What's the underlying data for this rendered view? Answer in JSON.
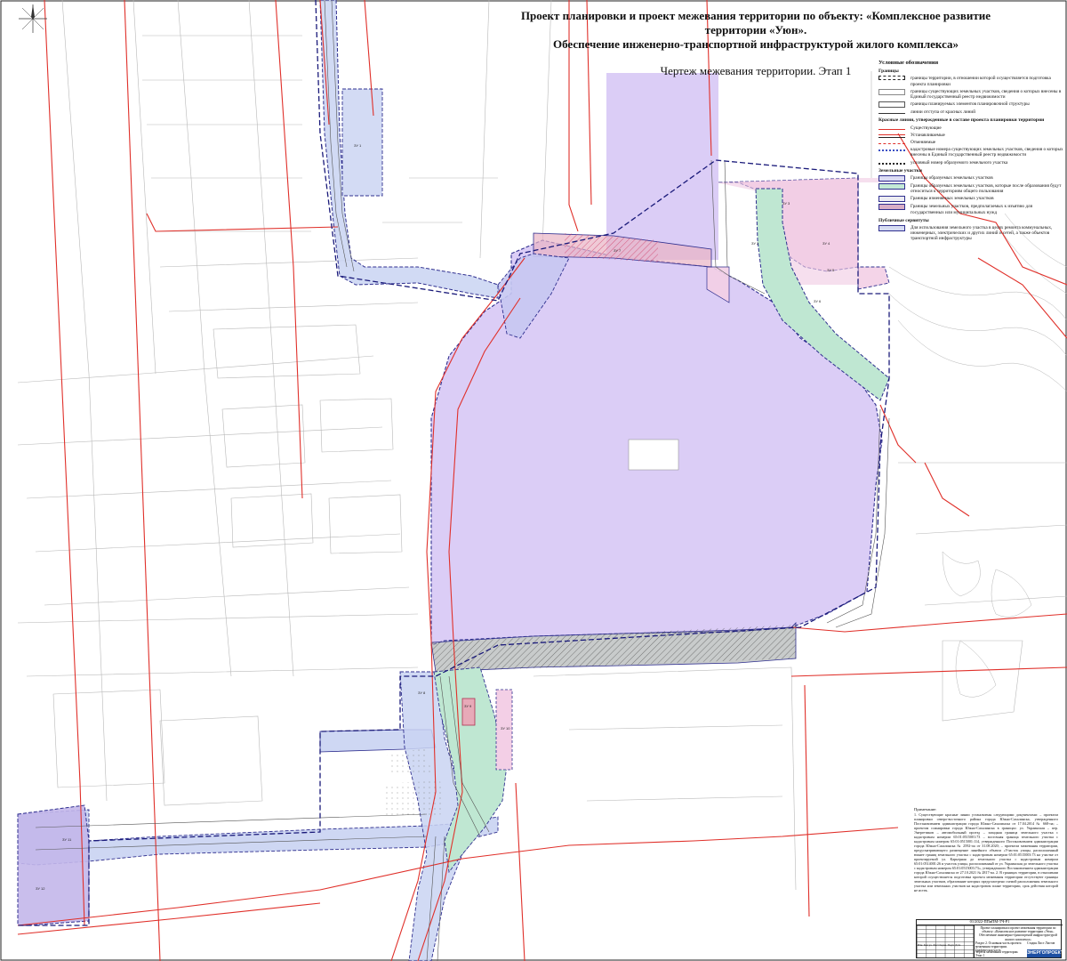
{
  "title": {
    "line1": "Проект планировки и проект межевания территории по объекту: «Комплексное развитие территории «Уюн».",
    "line2": "Обеспечение инженерно-транспортной инфраструктурой жилого комплекса»",
    "subtitle": "Чертеж межевания территории. Этап 1"
  },
  "legend": {
    "heading": "Условные обозначения",
    "groups": [
      {
        "title": "Границы",
        "items": [
          {
            "text": "границы территории, в отношении которой осуществляется подготовка проекта планировки",
            "style": "dashed-black",
            "color": "#222222"
          },
          {
            "text": "границы существующих земельных участков, сведения о которых внесены в Единый государственный реестр недвижимости",
            "style": "thin-grey",
            "color": "#888888"
          },
          {
            "text": "границы планируемых элементов планировочной структуры",
            "style": "box",
            "color": "#555555"
          },
          {
            "text": "линии отступа от красных линий",
            "style": "thin-line",
            "color": "#333333"
          }
        ]
      },
      {
        "title": "Красные линии, утвержденные в составе проекта планировки территории",
        "items": [
          {
            "text": "Существующие",
            "style": "red-line",
            "color": "#e0302a"
          },
          {
            "text": "Устанавливаемые",
            "style": "red-double",
            "color": "#e0302a"
          },
          {
            "text": "Отменяемые",
            "style": "red-cross",
            "color": "#e0302a"
          }
        ]
      },
      {
        "title": "",
        "items": [
          {
            "text": "кадастровые номера существующих земельных участков, сведения о которых внесены в Единый государственный реестр недвижимости",
            "style": "blue-text",
            "color": "#3a4fc4"
          },
          {
            "text": "условный номер образуемого земельного участка",
            "style": "dark-text",
            "color": "#222222"
          }
        ]
      },
      {
        "title": "Земельные участки",
        "items": [
          {
            "text": "Границы образуемых земельных участков",
            "style": "fill",
            "color": "#dcdcf4"
          },
          {
            "text": "Границы образуемых земельных участков, которые после образования будут относиться к территориям общего пользования",
            "style": "fill",
            "color": "#c4ead6"
          },
          {
            "text": "Границы изменяемых земельных участков",
            "style": "fill",
            "color": "#ececf2"
          },
          {
            "text": "Границы земельных участков, предполагаемых к изъятию для государственных или муниципальных нужд",
            "style": "fill",
            "color": "#d8aec6"
          }
        ]
      },
      {
        "title": "Публичные сервитуты",
        "items": [
          {
            "text": "Для использования земельного участка в целях ремонта коммунальных, инженерных, электрических и других линий и сетей, а также объектов транспортной инфраструктуры",
            "style": "fill",
            "color": "#d6dcf2"
          }
        ]
      }
    ]
  },
  "notes": {
    "heading": "Примечание:",
    "body": "1. Существующие красные линии установлены следующими документами: – проектом планировки северо-восточного района города Южно-Сахалинска, утвержденного Постановлением администрации города Южно-Сахалинска от 17.04.2014 № 668-па; – проектом планировки города Южно-Сахалинска в границах: ул. Украинская – пер. Энергетиков – автомобильный проезд – западная граница земельного участка с кадастровым номером 65:01:0515001:73 – восточная граница земельного участка с кадастровым номером 65:01:0515001:114, утвержденного Постановлением администрации города Южно-Сахалинска № 2592-па от 31.08.2020; – проектом межевания территории, предусматривающего размещение линейного объекта «Участок улицы, расположенный южнее границ земельного участка с кадастровым номером 65:01:0515003:73 на участке от проектируемой ул. Карьерная до земельного участка с кадастровым номером 65:01:0514001:26 и участок улицы, расположенный от ул. Украинская до земельного участка с кадастровым номером 65:01:0515003:73», утвержденного Постановлением администрации города Южно-Сахалинска от 27.10.2021 № 2817-па. 2. В границах территории, в отношении которой осуществляется подготовка проекта межевания территории отсутствуют границы земельных участков, образование которых предусмотрено схемой расположения земельного участка или земельных участков на кадастровом плане территории, срок действия которой не истек."
  },
  "stamp": {
    "code": "01/2022-ППиПМ-ТЧ-Р1",
    "description": "Проект планировки и проект межевания территории по объекту: «Комплексное развитие территории «Уюн». Обеспечение инженерно-транспортной инфраструктурой жилого комплекса»",
    "stage_text": "Раздел 2. Основная часть проекта межевания территории. Графическая часть",
    "sheet_info": "Стадия  Лист  Листов",
    "drawing_text": "Чертеж межевания территории. Этап 1",
    "company": "ЭНЕРГОПРОЕКТ",
    "roles": "Изм. Кол.уч. Лист №док. Подп. Дата"
  },
  "plots": [
    {
      "label": "ЗУ 1"
    },
    {
      "label": "ЗУ 2"
    },
    {
      "label": "ЗУ 3"
    },
    {
      "label": "ЗУ 4"
    },
    {
      "label": "ЗУ 5"
    },
    {
      "label": "ЗУ 6"
    },
    {
      "label": "ЗУ 7"
    },
    {
      "label": "ЗУ 8"
    },
    {
      "label": "ЗУ 9"
    },
    {
      "label": "ЗУ 10"
    },
    {
      "label": "ЗУ 11"
    },
    {
      "label": "ЗУ 12"
    }
  ],
  "colors": {
    "red_line": "#e0302a",
    "plot_purple": "#d7c8f5",
    "plot_pink": "#f3cfe6",
    "plot_green": "#bfe7d2",
    "plot_blue": "#c9d3f2",
    "seized": "#d8aec6",
    "boundary": "#2f2f8f"
  }
}
